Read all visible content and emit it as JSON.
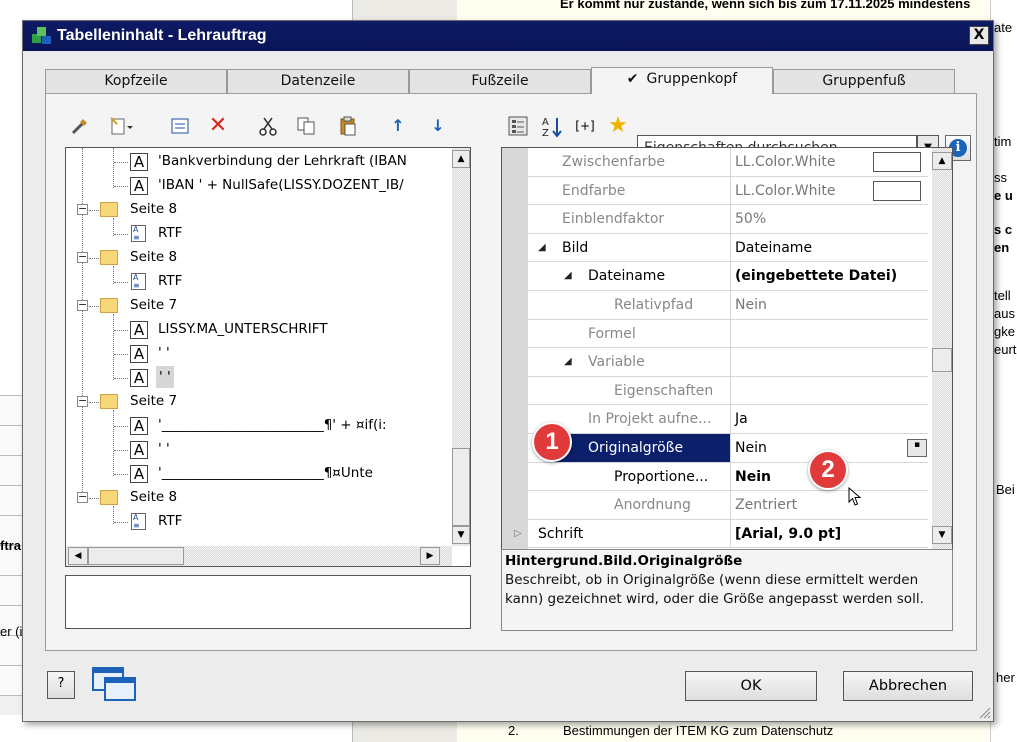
{
  "background": {
    "doc_lines": [
      {
        "text": "Er kommt nur zustande, wenn sich bis zum 17.11.2025 mindestens",
        "bold": false
      },
      {
        "text": "ate",
        "bold": false
      },
      {
        "text": "tim",
        "bold": false
      },
      {
        "text": "ss",
        "bold": false
      },
      {
        "text": "e u",
        "bold": false
      },
      {
        "text": "s c",
        "bold": true
      },
      {
        "text": "en",
        "bold": true
      },
      {
        "text": "tell",
        "bold": false
      },
      {
        "text": "aus",
        "bold": false
      },
      {
        "text": "gke",
        "bold": false
      },
      {
        "text": "eurt",
        "bold": false
      },
      {
        "text": "Bei",
        "bold": false
      },
      {
        "text": "her",
        "bold": false
      }
    ],
    "left_labels": [
      "ftra",
      "er (i"
    ],
    "footer_number": "2.",
    "footer_text": "Bestimmungen der ITEM KG zum Datenschutz"
  },
  "dialog": {
    "title": "Tabelleninhalt - Lehrauftrag",
    "close_label": "X",
    "tabs": [
      {
        "label": "Kopfzeile",
        "active": false
      },
      {
        "label": "Datenzeile",
        "active": false
      },
      {
        "label": "Fußzeile",
        "active": false
      },
      {
        "label": "Gruppenkopf",
        "active": true,
        "check": "✔"
      },
      {
        "label": "Gruppenfuß",
        "active": false
      }
    ],
    "tree": [
      {
        "type": "text",
        "label": "'Bankverbindung der Lehrkraft (IBAN"
      },
      {
        "type": "text",
        "label": "'IBAN  ' +   NullSafe(LISSY.DOZENT_IB/"
      },
      {
        "type": "folder",
        "label": "Seite 8"
      },
      {
        "type": "rtf",
        "label": "RTF"
      },
      {
        "type": "folder",
        "label": "Seite 8"
      },
      {
        "type": "rtf",
        "label": "RTF"
      },
      {
        "type": "folder",
        "label": "Seite 7"
      },
      {
        "type": "text",
        "label": "LISSY.MA_UNTERSCHRIFT"
      },
      {
        "type": "text",
        "label": "' '"
      },
      {
        "type": "text",
        "label": "' '"
      },
      {
        "type": "folder",
        "label": "Seite 7"
      },
      {
        "type": "text",
        "label": "'________________________¶' + ¤if(i:"
      },
      {
        "type": "text",
        "label": "' '"
      },
      {
        "type": "text",
        "label": "'________________________¶¤Unte"
      },
      {
        "type": "folder",
        "label": "Seite 8"
      },
      {
        "type": "rtf",
        "label": "RTF"
      }
    ],
    "search_placeholder": "Eigenschaften durchsuchen",
    "info_label": "i",
    "props": [
      {
        "name": "Zwischenfarbe",
        "value": "LL.Color.White",
        "indent": 1,
        "color_box": true
      },
      {
        "name": "Endfarbe",
        "value": "LL.Color.White",
        "indent": 1,
        "color_box": true
      },
      {
        "name": "Einblendfaktor",
        "value": "50%",
        "indent": 1
      },
      {
        "name": "Bild",
        "value": "Dateiname",
        "indent": 0,
        "expander": "◢",
        "dark": true
      },
      {
        "name": "Dateiname",
        "value": "(eingebettete Datei)",
        "indent": 1,
        "expander": "◢",
        "dark": true,
        "bold_value": true
      },
      {
        "name": "Relativpfad",
        "value": "Nein",
        "indent": 2
      },
      {
        "name": "Formel",
        "value": "",
        "indent": 1
      },
      {
        "name": "Variable",
        "value": "",
        "indent": 1,
        "expander": "◢"
      },
      {
        "name": "Eigenschaften",
        "value": "",
        "indent": 2
      },
      {
        "name": "In Projekt aufne...",
        "value": "Ja",
        "indent": 1,
        "dark_value": true
      },
      {
        "name": "Originalgröße",
        "value": "Nein",
        "indent": 1,
        "selected": true,
        "dropdown": true,
        "dark_value": true
      },
      {
        "name": "Proportione...",
        "value": "Nein",
        "indent": 2,
        "dark": true,
        "bold_value": true
      },
      {
        "name": "Anordnung",
        "value": "Zentriert",
        "indent": 2
      },
      {
        "name": "Schrift",
        "value": "[Arial, 9.0 pt]",
        "indent": 0,
        "expander": "▷",
        "dark": true,
        "bold_value": true
      }
    ],
    "desc_title": "Hintergrund.Bild.Originalgröße",
    "desc_text": "Beschreibt, ob in Originalgröße (wenn diese ermittelt werden kann) gezeichnet wird, oder die Größe angepasst werden soll.",
    "ok_label": "OK",
    "cancel_label": "Abbrechen",
    "help_label": "?"
  },
  "badges": [
    "1",
    "2"
  ],
  "colors": {
    "titlebar": "#0e1a66",
    "selection": "#0b1f6b",
    "badge": "#e03a3a"
  }
}
